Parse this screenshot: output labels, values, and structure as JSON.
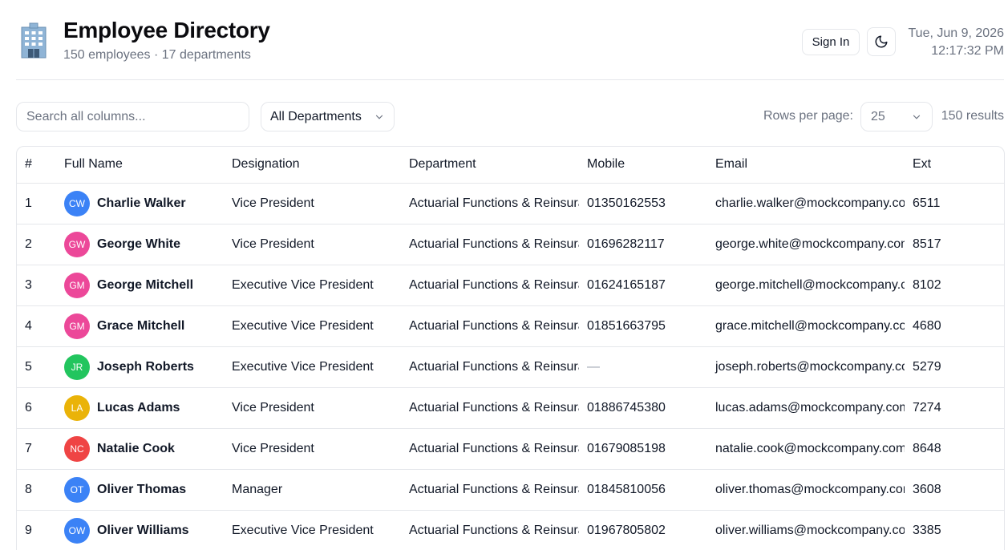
{
  "header": {
    "title": "Employee Directory",
    "subtitle": "150 employees · 17 departments",
    "logo_icon": "office-building-icon",
    "sign_in_label": "Sign In",
    "theme_icon": "moon-icon",
    "date": "Tue, Jun 9, 2026",
    "time": "12:17:32 PM"
  },
  "toolbar": {
    "search_placeholder": "Search all columns...",
    "department_filter": "All Departments",
    "rows_per_page_label": "Rows per page:",
    "rows_per_page_value": "25",
    "results": "150 results"
  },
  "table": {
    "columns": [
      "#",
      "Full Name",
      "Designation",
      "Department",
      "Mobile",
      "Email",
      "Ext"
    ],
    "rows": [
      {
        "num": "1",
        "initials": "CW",
        "avatar_color": "#3b82f6",
        "name": "Charlie Walker",
        "designation": "Vice President",
        "department": "Actuarial Functions & Reinsurance",
        "mobile": "01350162553",
        "email": "charlie.walker@mockcompany.com",
        "ext": "6511"
      },
      {
        "num": "2",
        "initials": "GW",
        "avatar_color": "#ec4899",
        "name": "George White",
        "designation": "Vice President",
        "department": "Actuarial Functions & Reinsurance",
        "mobile": "01696282117",
        "email": "george.white@mockcompany.com",
        "ext": "8517"
      },
      {
        "num": "3",
        "initials": "GM",
        "avatar_color": "#ec4899",
        "name": "George Mitchell",
        "designation": "Executive Vice President",
        "department": "Actuarial Functions & Reinsurance",
        "mobile": "01624165187",
        "email": "george.mitchell@mockcompany.com",
        "ext": "8102"
      },
      {
        "num": "4",
        "initials": "GM",
        "avatar_color": "#ec4899",
        "name": "Grace Mitchell",
        "designation": "Executive Vice President",
        "department": "Actuarial Functions & Reinsurance",
        "mobile": "01851663795",
        "email": "grace.mitchell@mockcompany.com",
        "ext": "4680"
      },
      {
        "num": "5",
        "initials": "JR",
        "avatar_color": "#22c55e",
        "name": "Joseph Roberts",
        "designation": "Executive Vice President",
        "department": "Actuarial Functions & Reinsurance",
        "mobile": "—",
        "email": "joseph.roberts@mockcompany.com",
        "ext": "5279"
      },
      {
        "num": "6",
        "initials": "LA",
        "avatar_color": "#eab308",
        "name": "Lucas Adams",
        "designation": "Vice President",
        "department": "Actuarial Functions & Reinsurance",
        "mobile": "01886745380",
        "email": "lucas.adams@mockcompany.com",
        "ext": "7274"
      },
      {
        "num": "7",
        "initials": "NC",
        "avatar_color": "#ef4444",
        "name": "Natalie Cook",
        "designation": "Vice President",
        "department": "Actuarial Functions & Reinsurance",
        "mobile": "01679085198",
        "email": "natalie.cook@mockcompany.com",
        "ext": "8648"
      },
      {
        "num": "8",
        "initials": "OT",
        "avatar_color": "#3b82f6",
        "name": "Oliver Thomas",
        "designation": "Manager",
        "department": "Actuarial Functions & Reinsurance",
        "mobile": "01845810056",
        "email": "oliver.thomas@mockcompany.com",
        "ext": "3608"
      },
      {
        "num": "9",
        "initials": "OW",
        "avatar_color": "#3b82f6",
        "name": "Oliver Williams",
        "designation": "Executive Vice President",
        "department": "Actuarial Functions & Reinsurance",
        "mobile": "01967805802",
        "email": "oliver.williams@mockcompany.com",
        "ext": "3385"
      }
    ]
  }
}
